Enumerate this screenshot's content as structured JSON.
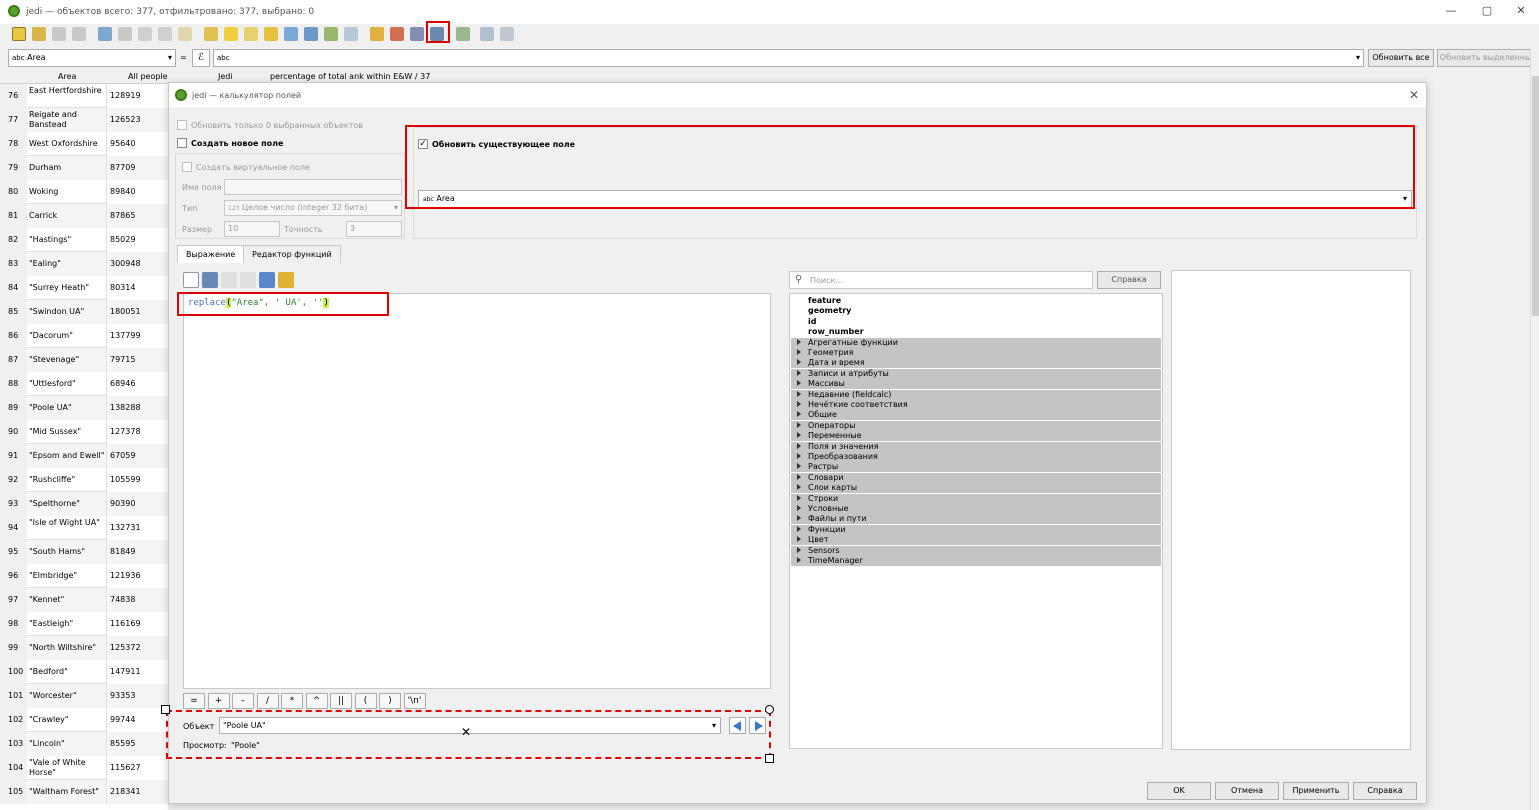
{
  "window": {
    "title": "jedi — объектов всего: 377, отфильтровано: 377, выбрано: 0",
    "minimize": "—",
    "maximize": "▢",
    "close": "✕"
  },
  "filter": {
    "field_type": "abc",
    "field": "Area",
    "eq": "=",
    "epsilon": "ℰ",
    "expr_type": "abc",
    "expr_value": "",
    "update_all": "Обновить все",
    "update_selected": "Обновить выделенные"
  },
  "table": {
    "headers": [
      "Area",
      "All people",
      "Jedi",
      "percentage of total  ank within E&W / 37"
    ],
    "rows": [
      {
        "num": "76",
        "area": "East Hertfordshire",
        "people": "128919"
      },
      {
        "num": "77",
        "area": "Reigate and Banstead",
        "people": "126523"
      },
      {
        "num": "78",
        "area": "West Oxfordshire",
        "people": "95640"
      },
      {
        "num": "79",
        "area": "Durham",
        "people": "87709"
      },
      {
        "num": "80",
        "area": "Woking",
        "people": "89840"
      },
      {
        "num": "81",
        "area": "Carrick",
        "people": "87865"
      },
      {
        "num": "82",
        "area": "\"Hastings\"",
        "people": "85029"
      },
      {
        "num": "83",
        "area": "\"Ealing\"",
        "people": "300948"
      },
      {
        "num": "84",
        "area": "\"Surrey Heath\"",
        "people": "80314"
      },
      {
        "num": "85",
        "area": "\"Swindon UA\"",
        "people": "180051"
      },
      {
        "num": "86",
        "area": "\"Dacorum\"",
        "people": "137799"
      },
      {
        "num": "87",
        "area": "\"Stevenage\"",
        "people": "79715"
      },
      {
        "num": "88",
        "area": "\"Uttlesford\"",
        "people": "68946"
      },
      {
        "num": "89",
        "area": "\"Poole UA\"",
        "people": "138288"
      },
      {
        "num": "90",
        "area": "\"Mid Sussex\"",
        "people": "127378"
      },
      {
        "num": "91",
        "area": "\"Epsom and Ewell\"",
        "people": "67059"
      },
      {
        "num": "92",
        "area": "\"Rushcliffe\"",
        "people": "105599"
      },
      {
        "num": "93",
        "area": "\"Spelthorne\"",
        "people": "90390"
      },
      {
        "num": "94",
        "area": "\"Isle of Wight UA\"",
        "people": "132731"
      },
      {
        "num": "95",
        "area": "\"South Hams\"",
        "people": "81849"
      },
      {
        "num": "96",
        "area": "\"Elmbridge\"",
        "people": "121936"
      },
      {
        "num": "97",
        "area": "\"Kennet\"",
        "people": "74838"
      },
      {
        "num": "98",
        "area": "\"Eastleigh\"",
        "people": "116169"
      },
      {
        "num": "99",
        "area": "\"North Wiltshire\"",
        "people": "125372"
      },
      {
        "num": "100",
        "area": "\"Bedford\"",
        "people": "147911"
      },
      {
        "num": "101",
        "area": "\"Worcester\"",
        "people": "93353"
      },
      {
        "num": "102",
        "area": "\"Crawley\"",
        "people": "99744"
      },
      {
        "num": "103",
        "area": "\"Lincoln\"",
        "people": "85595"
      },
      {
        "num": "104",
        "area": "\"Vale of White Horse\"",
        "people": "115627"
      },
      {
        "num": "105",
        "area": "\"Waltham Forest\"",
        "people": "218341"
      }
    ]
  },
  "dialog": {
    "title": "jedi — калькулятор полей",
    "update_selected_only": "Обновить только 0 выбранных объектов",
    "create_new_field": "Создать новое поле",
    "create_virtual": "Создать виртуальное поле",
    "field_name_label": "Имя поля",
    "type_label": "Тип",
    "type_value": "Целое число (integer 32 бита)",
    "type_prefix": "123",
    "size_label": "Размер",
    "size_value": "10",
    "precision_label": "Точность",
    "precision_value": "3",
    "update_existing": "Обновить существующее поле",
    "existing_field_type": "abc",
    "existing_field": "Area",
    "tabs": [
      "Выражение",
      "Редактор функций"
    ],
    "expression": {
      "fn": "replace",
      "open": "(",
      "args": "\"Area\", ' UA', ''",
      "close": ")"
    },
    "search_placeholder": "Поиск...",
    "help_button": "Справка",
    "fields": [
      "feature",
      "geometry",
      "id",
      "row_number"
    ],
    "groups": [
      "Агрегатные функции",
      "Геометрия",
      "Дата и время",
      "Записи и атрибуты",
      "Массивы",
      "Недавние (fieldcalc)",
      "Нечёткие соответствия",
      "Общие",
      "Операторы",
      "Переменные",
      "Поля и значения",
      "Преобразования",
      "Растры",
      "Словари",
      "Слои карты",
      "Строки",
      "Условные",
      "Файлы и пути",
      "Функции",
      "Цвет",
      "Sensors",
      "TimeManager"
    ],
    "operators": [
      "=",
      "+",
      "-",
      "/",
      "*",
      "^",
      "||",
      "(",
      ")",
      "'\\n'"
    ],
    "object_label": "Объект",
    "object_value": "\"Poole UA\"",
    "preview_label": "Просмотр:",
    "preview_value": "\"Poole\"",
    "ok": "OK",
    "cancel": "Отмена",
    "apply": "Применить",
    "help": "Справка"
  }
}
